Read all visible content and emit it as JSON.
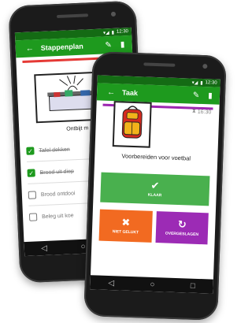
{
  "back_phone": {
    "status_time": "12:30",
    "app_title": "Stappenplan",
    "step_title": "Ontbijt m",
    "checklist": [
      {
        "label": "Tafel dekken",
        "checked": true
      },
      {
        "label": "Brood uit diep",
        "checked": true
      },
      {
        "label": "Brood ontdooi",
        "checked": false
      },
      {
        "label": "Beleg uit koe",
        "checked": false
      }
    ]
  },
  "front_phone": {
    "status_time": "12:30",
    "app_title": "Taak",
    "timer": "16:30",
    "task_title": "Voorbereiden voor voetbal",
    "buttons": {
      "done": "KLAAR",
      "fail": "NIET GELUKT",
      "skip": "OVERGESLAGEN"
    }
  },
  "colors": {
    "appbar": "#1e9a1e",
    "statusbar": "#146b14",
    "done": "#49b04e",
    "fail": "#f26a21",
    "skip": "#9c2bb5",
    "progress_back": "#e53935",
    "progress_front": "#9c27b0"
  },
  "icons": {
    "back": "arrow-back-icon",
    "edit": "pencil-icon",
    "delete": "trash-icon",
    "done": "checkmark-icon",
    "fail": "x-icon",
    "skip": "redo-icon",
    "timer": "hourglass-icon"
  }
}
